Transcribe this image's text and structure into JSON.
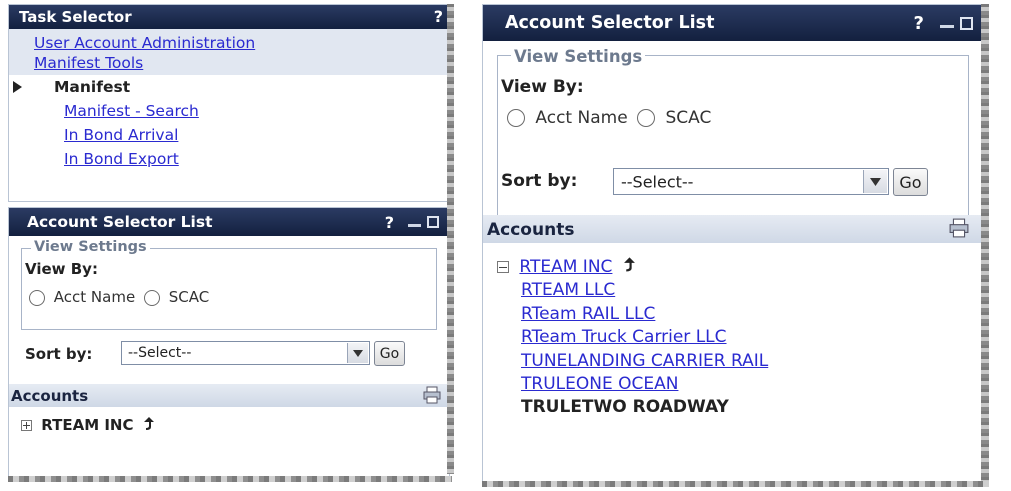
{
  "left_panel": {
    "task_selector": {
      "title": "Task Selector",
      "help": "?",
      "links": [
        "User Account Administration",
        "Manifest Tools"
      ],
      "current": "Manifest",
      "sublinks": [
        "Manifest - Search",
        "In Bond Arrival",
        "In Bond Export"
      ]
    },
    "account_selector": {
      "title": "Account Selector List",
      "help": "?",
      "view_settings": "View Settings",
      "view_by": "View By:",
      "radio_acct": "Acct Name",
      "radio_scac": "SCAC",
      "sort_by": "Sort by:",
      "select_value": "--Select--",
      "go": "Go",
      "accounts_header": "Accounts",
      "accounts": [
        "RTEAM INC"
      ]
    }
  },
  "right_panel": {
    "title": "Account Selector List",
    "help": "?",
    "view_settings": "View Settings",
    "view_by": "View By:",
    "radio_acct": "Acct Name",
    "radio_scac": "SCAC",
    "sort_by": "Sort by:",
    "select_value": "--Select--",
    "go": "Go",
    "accounts_header": "Accounts",
    "accounts_parent": "RTEAM INC",
    "accounts_children": [
      "RTEAM LLC",
      "RTeam RAIL LLC",
      "RTeam Truck Carrier LLC",
      "TUNELANDING CARRIER RAIL",
      "TRULEONE OCEAN"
    ],
    "accounts_current": "TRULETWO ROADWAY"
  },
  "colors": {
    "titlebar": "#1b2a4e",
    "link": "#2a2ad0",
    "section_bar": "#d6deea"
  },
  "icons": [
    "expand-plus-icon",
    "collapse-minus-icon",
    "up-arrow-icon",
    "print-icon",
    "minimize-icon",
    "maximize-icon",
    "help-icon",
    "current-item-arrow-icon",
    "dropdown-arrow-icon"
  ]
}
